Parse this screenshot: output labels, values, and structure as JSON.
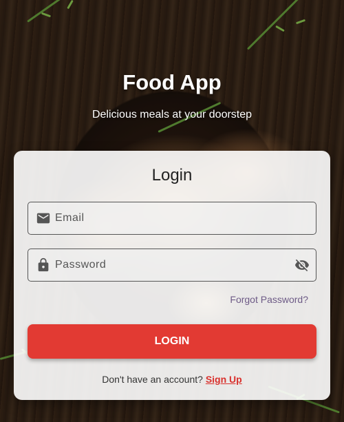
{
  "header": {
    "title": "Food App",
    "tagline": "Delicious meals at your doorstep"
  },
  "login_card": {
    "title": "Login",
    "email_field": {
      "placeholder": "Email",
      "value": "",
      "icon": "mail-icon"
    },
    "password_field": {
      "placeholder": "Password",
      "value": "",
      "icon": "lock-icon",
      "toggle_icon": "visibility-off-icon"
    },
    "forgot_password_label": "Forgot Password?",
    "login_button_label": "LOGIN",
    "signup_prompt": "Don't have an account?",
    "signup_link_label": "Sign Up"
  },
  "colors": {
    "primary": "#e23a33",
    "link": "#6d5a86",
    "signup_link": "#d9302c"
  }
}
